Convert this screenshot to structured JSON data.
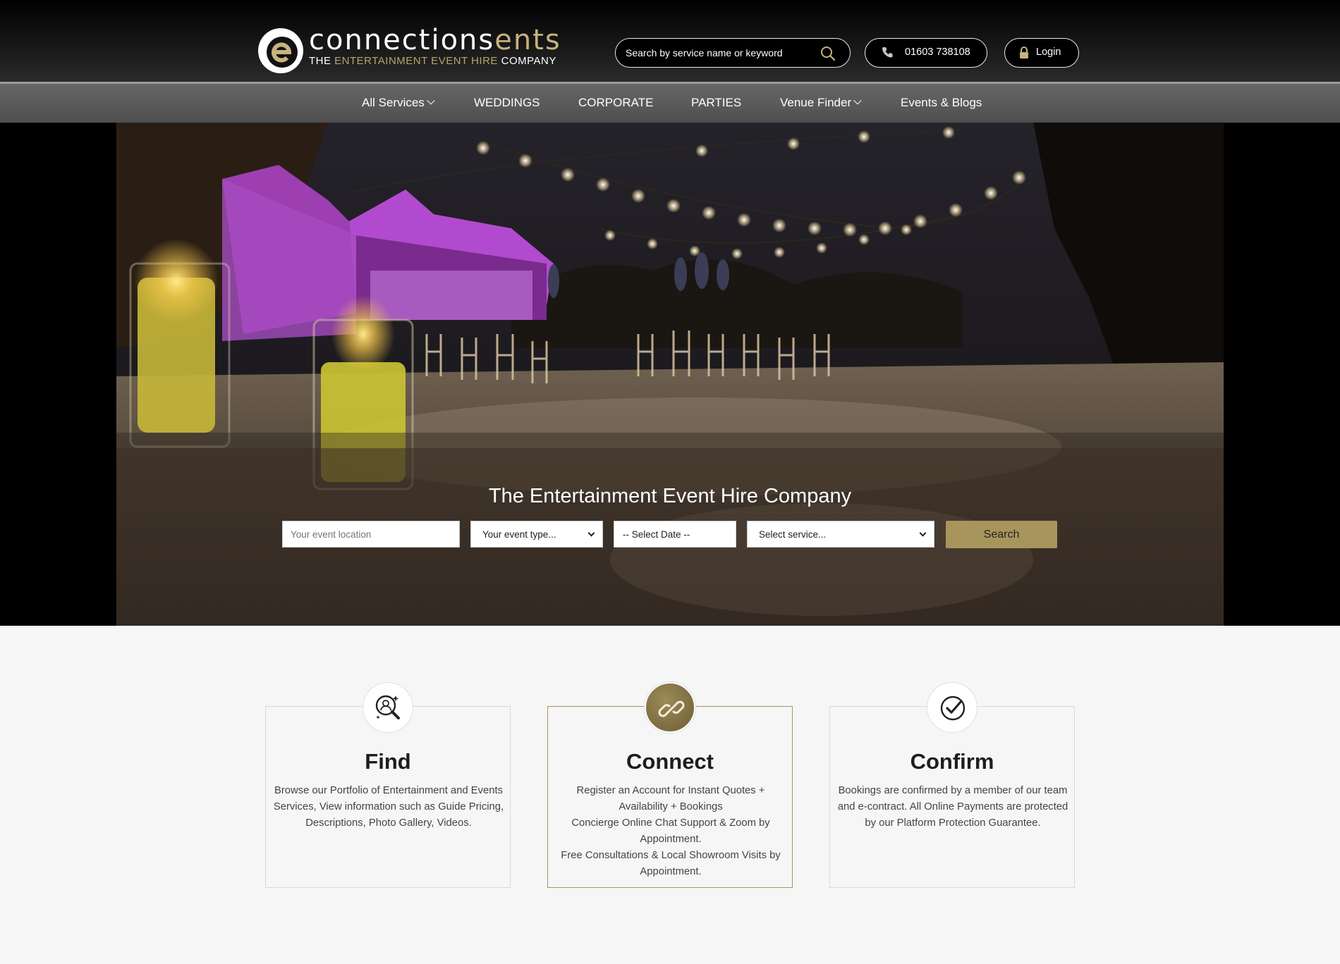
{
  "header": {
    "logo": {
      "name_white": "connections",
      "name_gold": "ents",
      "tag_white_1": "THE ",
      "tag_gold": "ENTERTAINMENT EVENT HIRE",
      "tag_white_2": " COMPANY"
    },
    "search_placeholder": "Search by service name or keyword",
    "phone": "01603 738108",
    "login": "Login"
  },
  "nav": {
    "items": [
      {
        "label": "All Services",
        "dropdown": true
      },
      {
        "label": "WEDDINGS",
        "dropdown": false
      },
      {
        "label": "CORPORATE",
        "dropdown": false
      },
      {
        "label": "PARTIES",
        "dropdown": false
      },
      {
        "label": "Venue Finder",
        "dropdown": true
      },
      {
        "label": "Events & Blogs",
        "dropdown": false
      }
    ]
  },
  "hero": {
    "title": "The Entertainment Event Hire Company",
    "location_placeholder": "Your event location",
    "event_type": "Your event type...",
    "date": "-- Select Date --",
    "service": "Select service...",
    "search_label": "Search"
  },
  "steps": [
    {
      "title": "Find",
      "icon": "magnifier-person-icon",
      "text": "Browse our Portfolio of Entertainment and Events Services, View information such as Guide Pricing, Descriptions, Photo Gallery, Videos."
    },
    {
      "title": "Connect",
      "icon": "link-chain-icon",
      "text_lines": [
        "Register an Account for Instant Quotes + Availability + Bookings",
        "Concierge Online Chat Support & Zoom by Appointment.",
        "Free Consultations & Local Showroom Visits by Appointment."
      ]
    },
    {
      "title": "Confirm",
      "icon": "check-circle-icon",
      "text": "Bookings are confirmed by a member of our team and e-contract. All Online Payments are protected by our Platform Protection Guarantee."
    }
  ],
  "colors": {
    "gold": "#a8955c",
    "header_bg": "#000000",
    "nav_bg": "#5b5b5b",
    "page_bg": "#f6f6f6"
  }
}
